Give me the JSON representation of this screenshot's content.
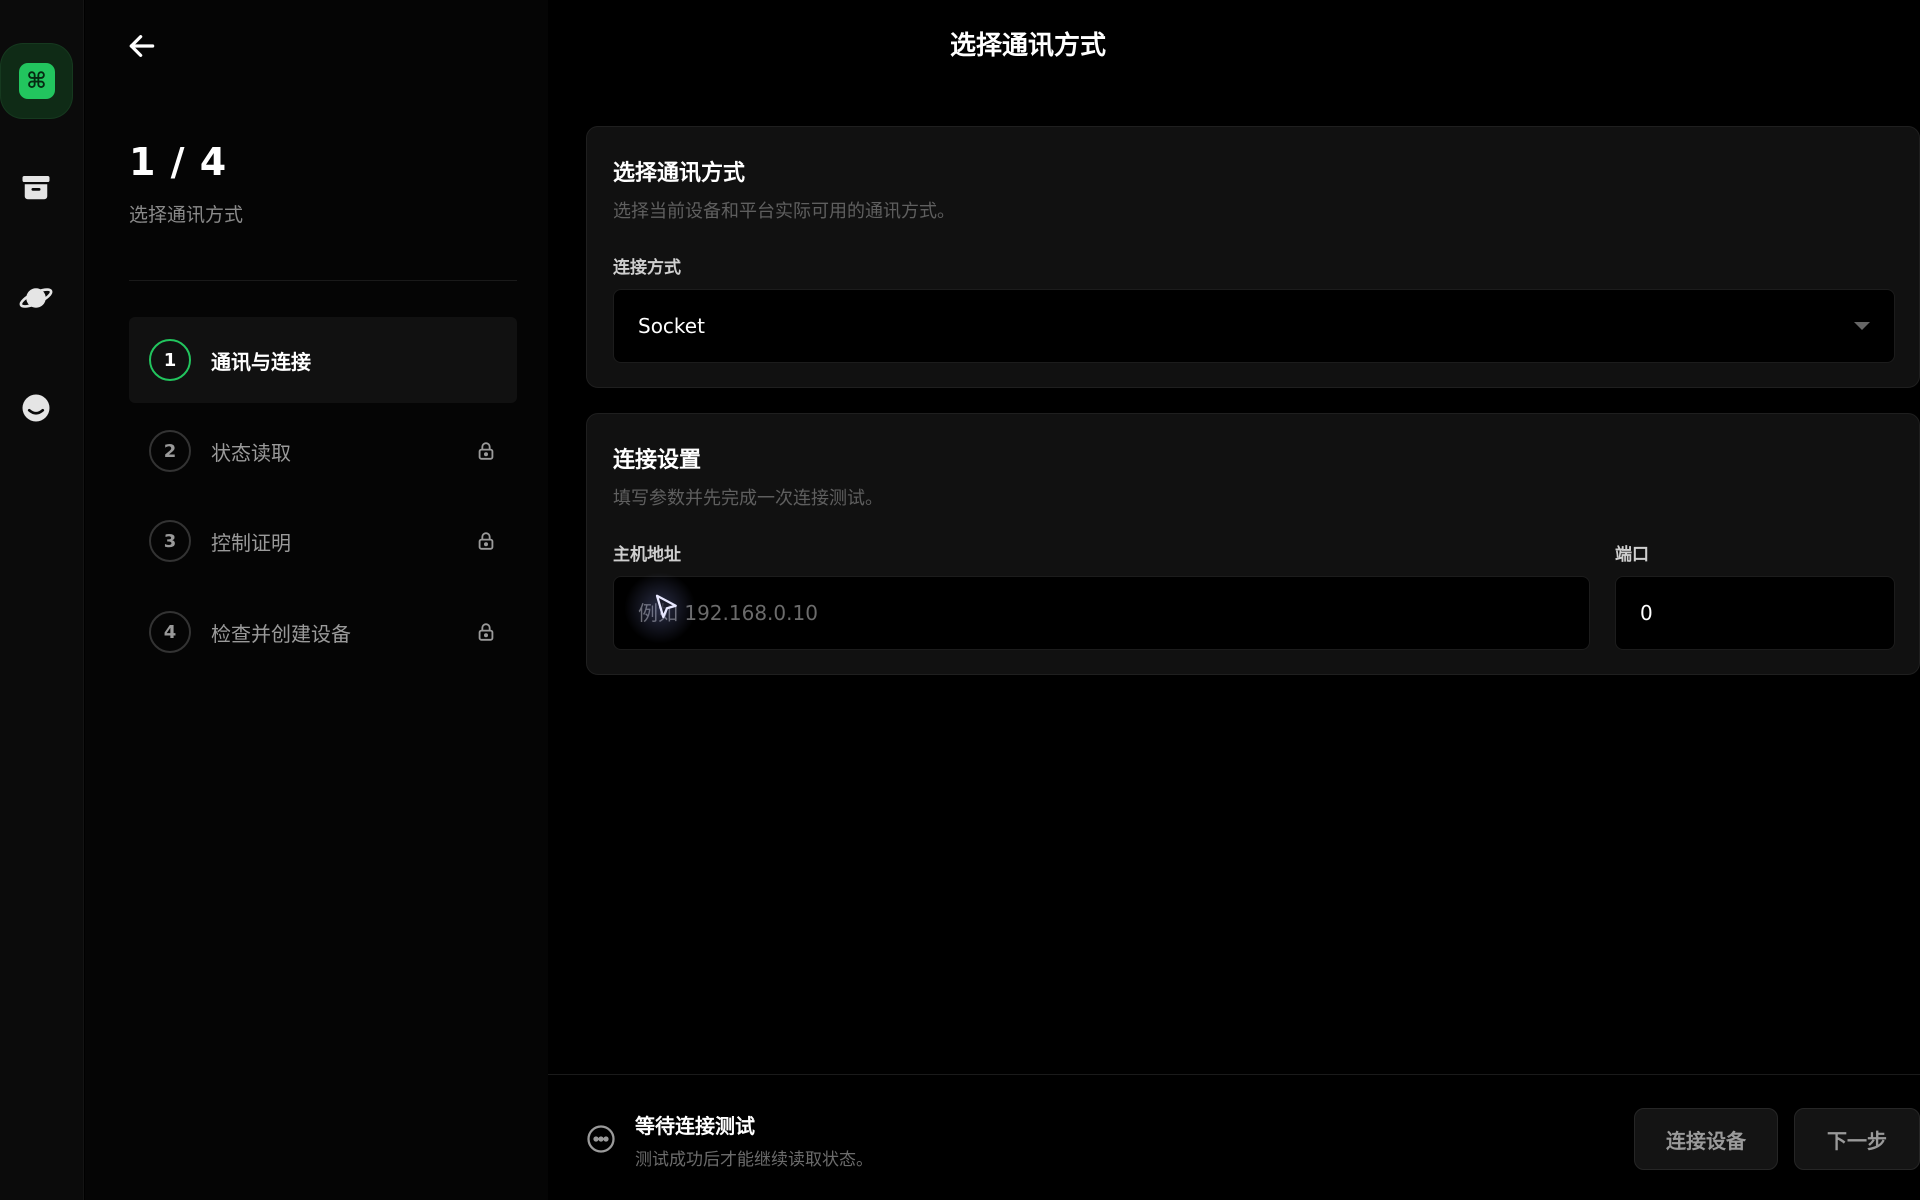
{
  "header": {
    "title": "选择通讯方式"
  },
  "progress": {
    "current": 1,
    "total": 4,
    "label": "1 / 4",
    "subtitle": "选择通讯方式"
  },
  "rail": {
    "items": [
      {
        "icon": "command-icon"
      },
      {
        "icon": "archive-icon"
      },
      {
        "icon": "planet-icon"
      },
      {
        "icon": "face-icon"
      }
    ]
  },
  "steps": [
    {
      "number": "1",
      "label": "通讯与连接",
      "active": true,
      "locked": false
    },
    {
      "number": "2",
      "label": "状态读取",
      "active": false,
      "locked": true
    },
    {
      "number": "3",
      "label": "控制证明",
      "active": false,
      "locked": true
    },
    {
      "number": "4",
      "label": "检查并创建设备",
      "active": false,
      "locked": true
    }
  ],
  "comm_card": {
    "title": "选择通讯方式",
    "description": "选择当前设备和平台实际可用的通讯方式。",
    "field_label": "连接方式",
    "selected": "Socket"
  },
  "conn_card": {
    "title": "连接设置",
    "description": "填写参数并先完成一次连接测试。",
    "host_label": "主机地址",
    "host_placeholder": "例如 192.168.0.10",
    "port_label": "端口",
    "port_value": "0"
  },
  "footer": {
    "status_title": "等待连接测试",
    "status_desc": "测试成功后才能继续读取状态。",
    "connect_button": "连接设备",
    "next_button": "下一步"
  },
  "colors": {
    "accent": "#22c55e",
    "background": "#000000",
    "card": "#111111"
  }
}
